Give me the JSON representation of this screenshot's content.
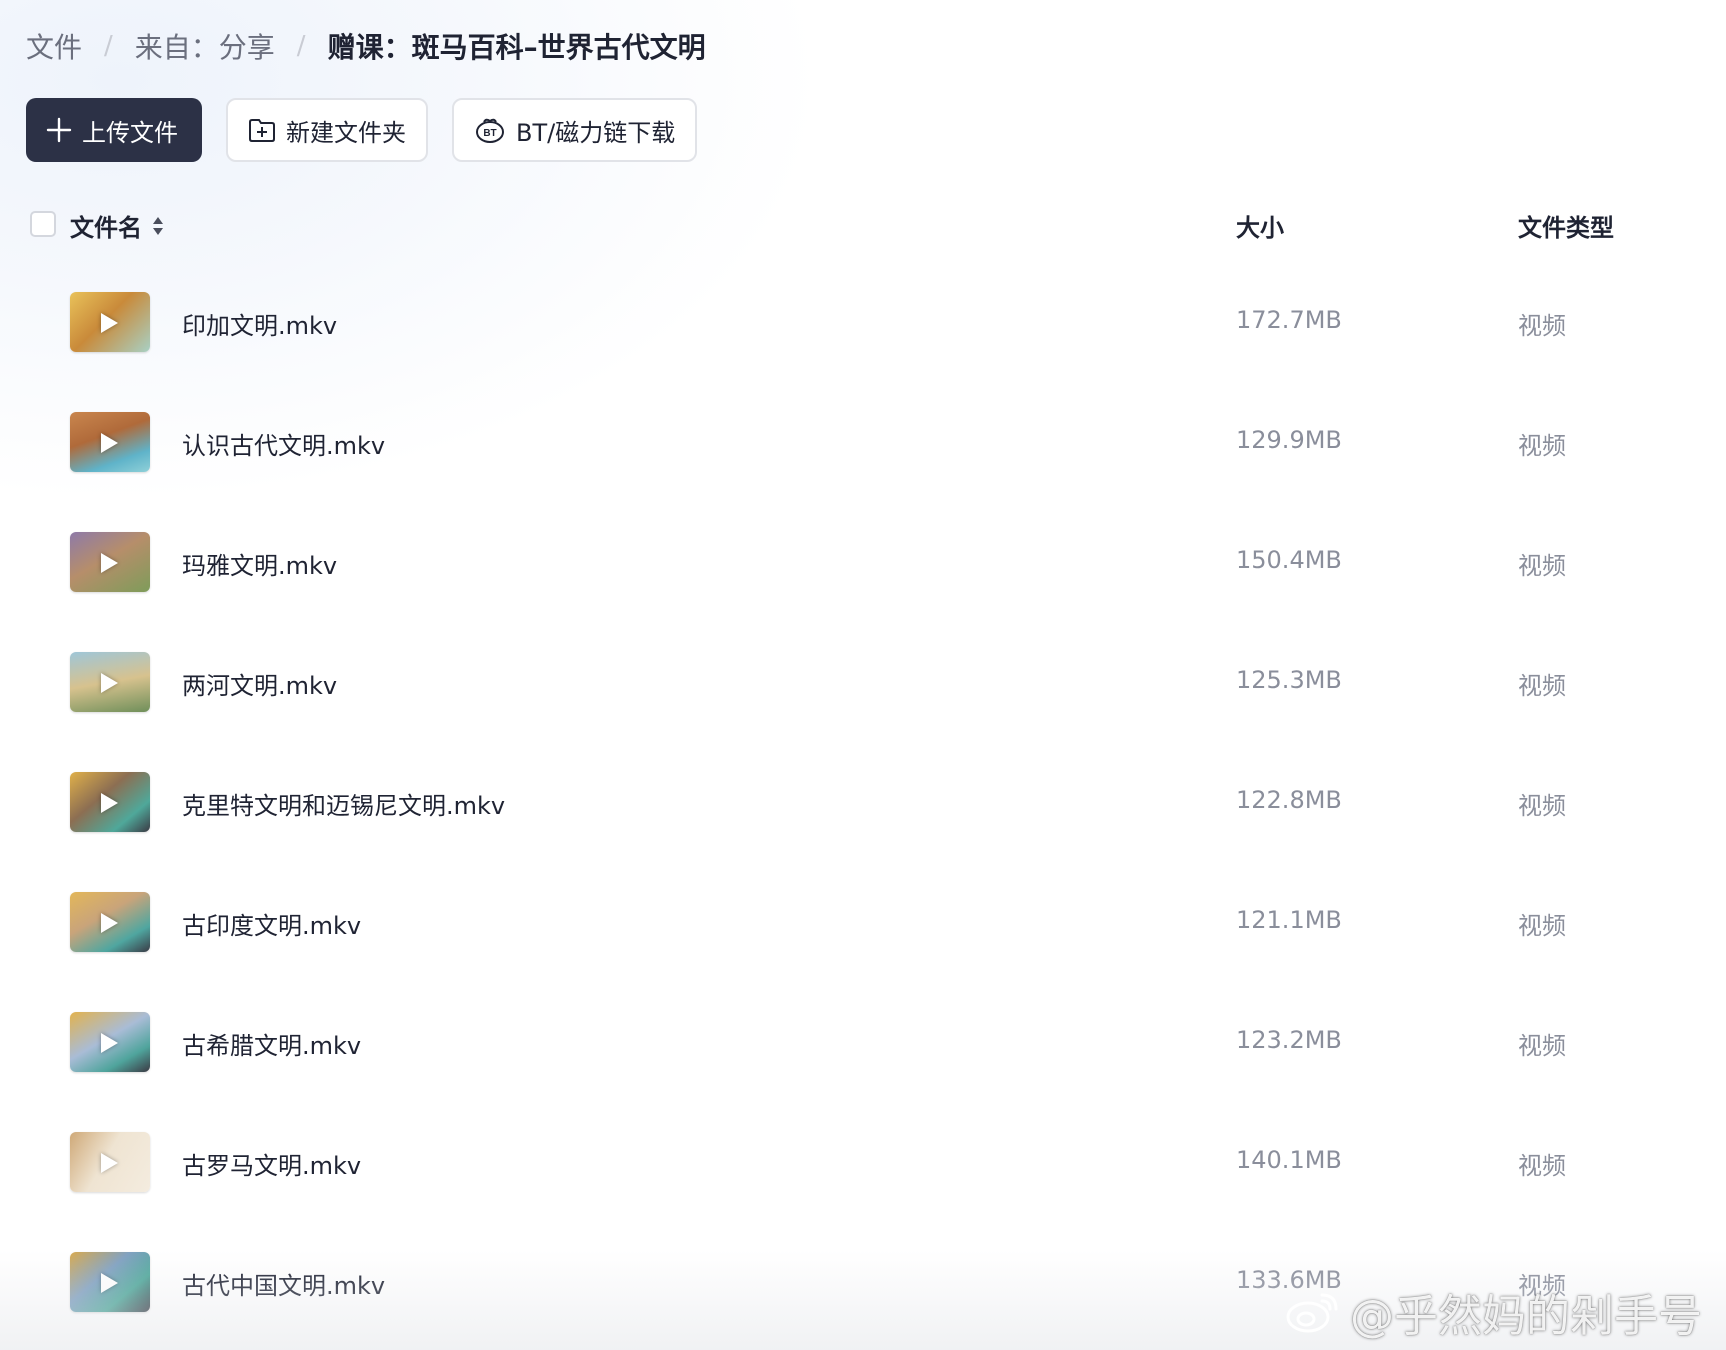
{
  "breadcrumb": {
    "root": "文件",
    "sep1": "/",
    "source": "来自：分享",
    "sep2": "/",
    "current": "赠课：斑马百科–世界古代文明"
  },
  "toolbar": {
    "upload_label": "上传文件",
    "new_folder_label": "新建文件夹",
    "bt_label": "BT/磁力链下载"
  },
  "table": {
    "columns": {
      "name": "文件名",
      "size": "大小",
      "type": "文件类型"
    },
    "rows": [
      {
        "name": "印加文明.mkv",
        "size": "172.7MB",
        "type": "视频"
      },
      {
        "name": "认识古代文明.mkv",
        "size": "129.9MB",
        "type": "视频"
      },
      {
        "name": "玛雅文明.mkv",
        "size": "150.4MB",
        "type": "视频"
      },
      {
        "name": "两河文明.mkv",
        "size": "125.3MB",
        "type": "视频"
      },
      {
        "name": "克里特文明和迈锡尼文明.mkv",
        "size": "122.8MB",
        "type": "视频"
      },
      {
        "name": "古印度文明.mkv",
        "size": "121.1MB",
        "type": "视频"
      },
      {
        "name": "古希腊文明.mkv",
        "size": "123.2MB",
        "type": "视频"
      },
      {
        "name": "古罗马文明.mkv",
        "size": "140.1MB",
        "type": "视频"
      },
      {
        "name": "古代中国文明.mkv",
        "size": "133.6MB",
        "type": "视频"
      }
    ]
  },
  "watermark": {
    "text": "@乎然妈的剁手号"
  },
  "colors": {
    "primary_button": "#2c3146",
    "text_main": "#1f2333",
    "text_muted": "#8a8e9b",
    "border": "#e1e3e8"
  },
  "icons": {
    "upload": "plus-icon",
    "new_folder": "folder-plus-icon",
    "bt": "bt-icon",
    "sort": "sort-icon",
    "thumbnail_overlay": "play-icon",
    "watermark_logo": "weibo-icon"
  }
}
